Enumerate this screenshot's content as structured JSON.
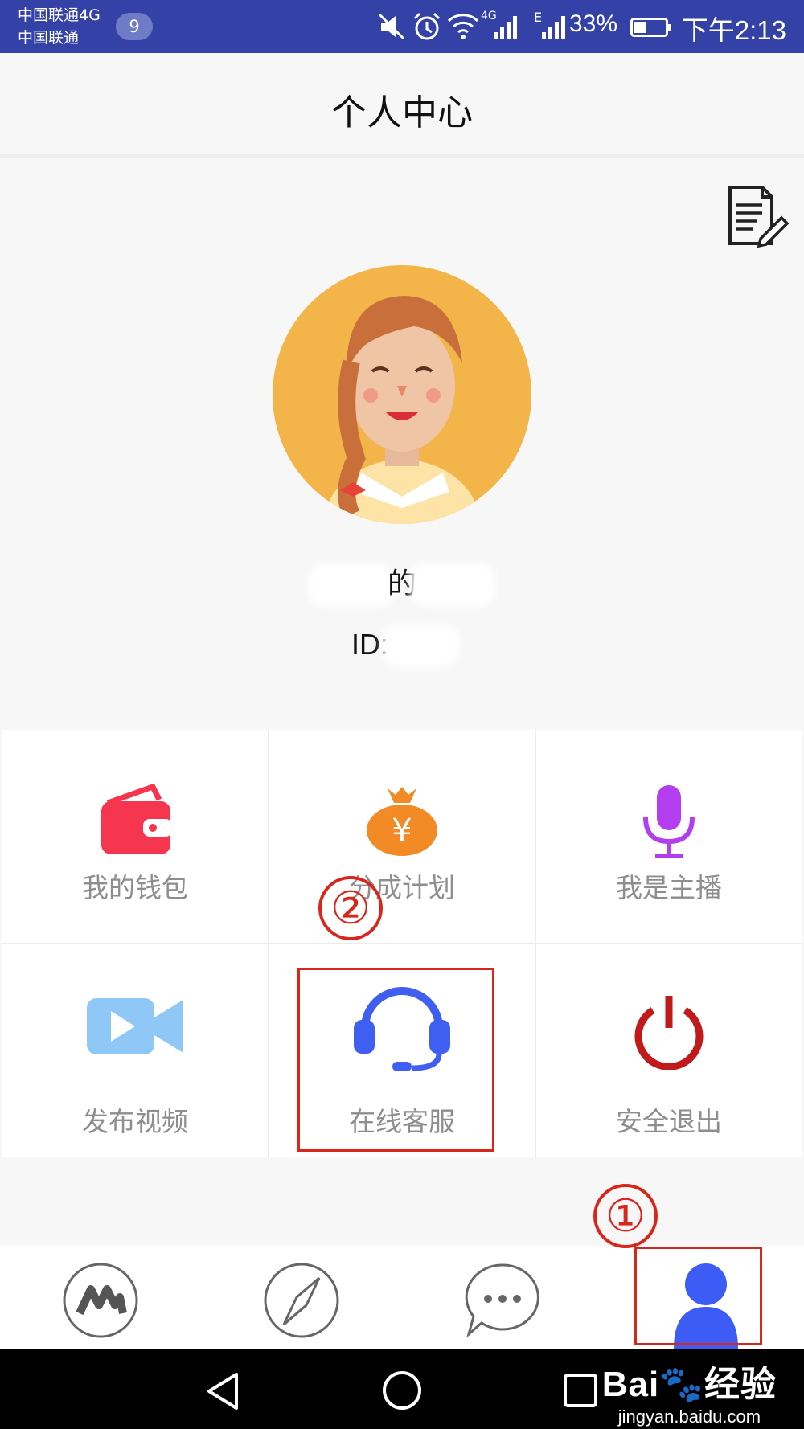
{
  "status_bar": {
    "carrier_1": "中国联通4G",
    "carrier_2": "中国联通",
    "notification_count": "9",
    "net_1": "4G",
    "net_2": "E",
    "battery_percent": "33%",
    "time": "下午2:13"
  },
  "header": {
    "title": "个人中心"
  },
  "profile": {
    "name_suffix": "的",
    "id_label": "ID:"
  },
  "menu": {
    "wallet": "我的钱包",
    "share_plan": "分成计划",
    "streamer": "我是主播",
    "publish_video": "发布视频",
    "online_service": "在线客服",
    "logout": "安全退出",
    "yen_symbol": "¥"
  },
  "annotations": {
    "one": "①",
    "two": "②"
  },
  "watermark": {
    "logo": "Bai🐾经验",
    "url": "jingyan.baidu.com"
  },
  "colors": {
    "status_bar": "#3442a8",
    "wallet": "#f6354f",
    "money_bag": "#f28a26",
    "microphone": "#b23ef0",
    "video": "#8fc8f7",
    "headset": "#3f5ef2",
    "power": "#c21a1a",
    "profile_tab": "#3d5cf5",
    "annotation": "#d9261c"
  }
}
